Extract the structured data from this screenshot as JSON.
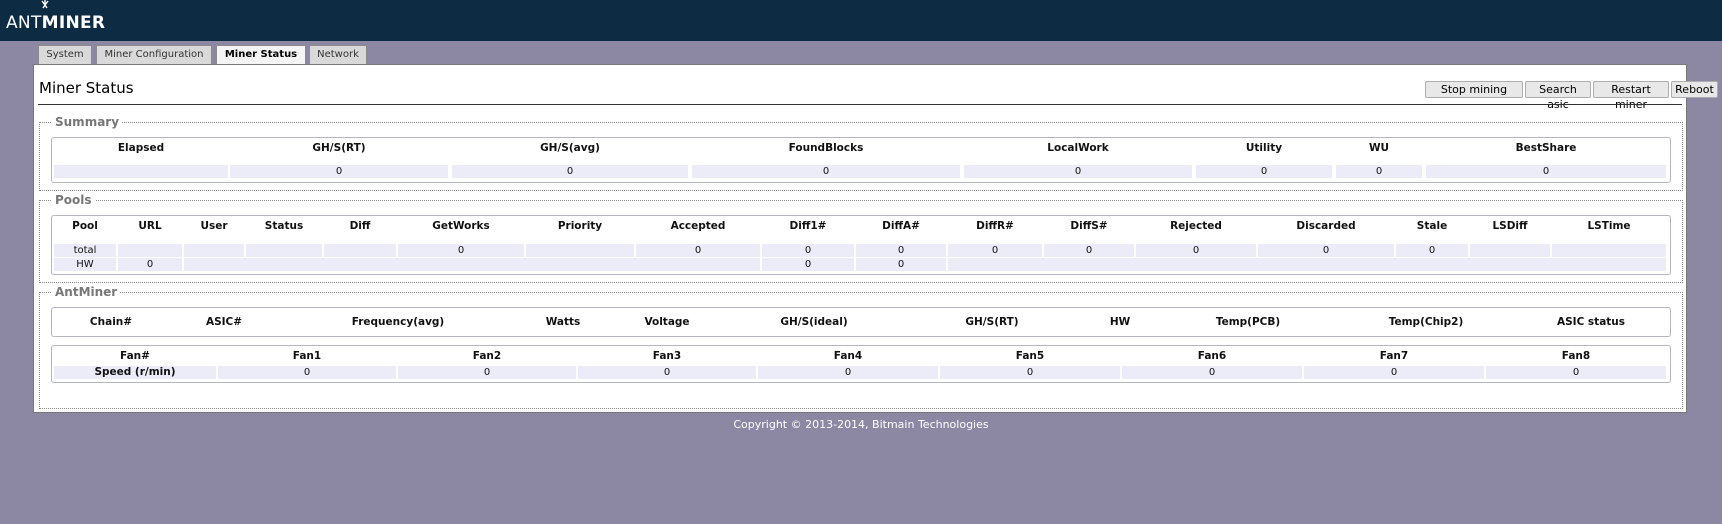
{
  "header": {
    "logo_ant": "ANT",
    "logo_miner": "MINER"
  },
  "tabs": [
    {
      "label": "System"
    },
    {
      "label": "Miner Configuration"
    },
    {
      "label": "Miner Status"
    },
    {
      "label": "Network"
    }
  ],
  "page": {
    "title": "Miner Status",
    "buttons": {
      "stop": "Stop mining",
      "search": "Search asic",
      "restart": "Restart miner",
      "reboot": "Reboot"
    }
  },
  "summary": {
    "legend": "Summary",
    "headers": [
      "Elapsed",
      "GH/S(RT)",
      "GH/S(avg)",
      "FoundBlocks",
      "LocalWork",
      "Utility",
      "WU",
      "BestShare"
    ],
    "row": [
      "",
      "0",
      "0",
      "0",
      "0",
      "0",
      "0",
      "0"
    ]
  },
  "pools": {
    "legend": "Pools",
    "headers": [
      "Pool",
      "URL",
      "User",
      "Status",
      "Diff",
      "GetWorks",
      "Priority",
      "Accepted",
      "Diff1#",
      "DiffA#",
      "DiffR#",
      "DiffS#",
      "Rejected",
      "Discarded",
      "Stale",
      "LSDiff",
      "LSTime"
    ],
    "total": [
      "total",
      "",
      "",
      "",
      "",
      "0",
      "",
      "0",
      "0",
      "0",
      "0",
      "0",
      "0",
      "0",
      "0",
      "",
      ""
    ],
    "hw": [
      "HW",
      "0",
      "",
      "",
      "",
      "",
      "",
      "",
      "0",
      "0",
      "",
      "",
      "",
      "",
      "",
      "",
      ""
    ]
  },
  "antminer": {
    "legend": "AntMiner",
    "chain_headers": [
      "Chain#",
      "ASIC#",
      "Frequency(avg)",
      "Watts",
      "Voltage",
      "GH/S(ideal)",
      "GH/S(RT)",
      "HW",
      "Temp(PCB)",
      "Temp(Chip2)",
      "ASIC status"
    ],
    "fan_headers": [
      "Fan#",
      "Fan1",
      "Fan2",
      "Fan3",
      "Fan4",
      "Fan5",
      "Fan6",
      "Fan7",
      "Fan8"
    ],
    "fan_speed": [
      "Speed (r/min)",
      "0",
      "0",
      "0",
      "0",
      "0",
      "0",
      "0",
      "0"
    ]
  },
  "footer": {
    "copyright": "Copyright © 2013-2014, Bitmain Technologies"
  }
}
